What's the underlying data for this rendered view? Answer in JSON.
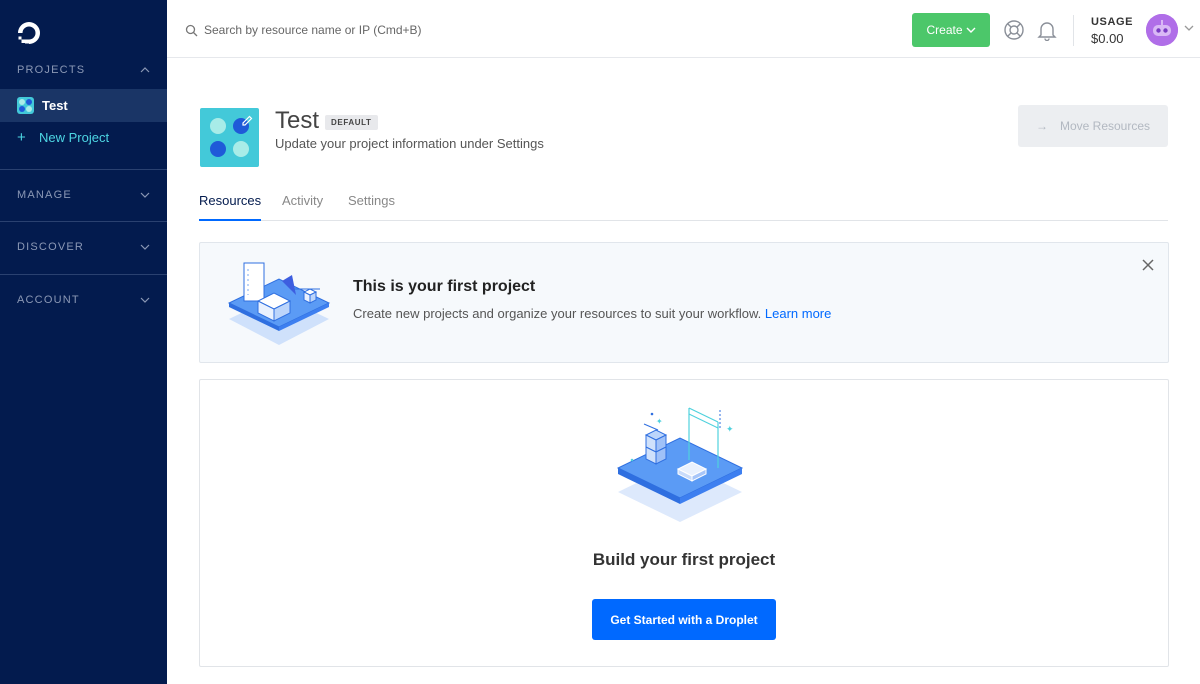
{
  "sidebar": {
    "sections": {
      "projects": "PROJECTS",
      "manage": "MANAGE",
      "discover": "DISCOVER",
      "account": "ACCOUNT"
    },
    "active_project": "Test",
    "new_project": "New Project"
  },
  "header": {
    "search_placeholder": "Search by resource name or IP (Cmd+B)",
    "create_label": "Create",
    "usage_label": "USAGE",
    "usage_value": "$0.00"
  },
  "project": {
    "name": "Test",
    "badge": "DEFAULT",
    "subtitle": "Update your project information under Settings",
    "move_resources": "Move Resources"
  },
  "tabs": [
    {
      "label": "Resources",
      "active": true
    },
    {
      "label": "Activity",
      "active": false
    },
    {
      "label": "Settings",
      "active": false
    }
  ],
  "banner": {
    "title": "This is your first project",
    "text": "Create new projects and organize your resources to suit your workflow.",
    "link": "Learn more"
  },
  "empty_state": {
    "title": "Build your first project",
    "cta": "Get Started with a Droplet"
  },
  "colors": {
    "sidebar_bg": "#031b4e",
    "accent_blue": "#0069ff",
    "create_green": "#4cc76a",
    "teal": "#43c9d9"
  }
}
